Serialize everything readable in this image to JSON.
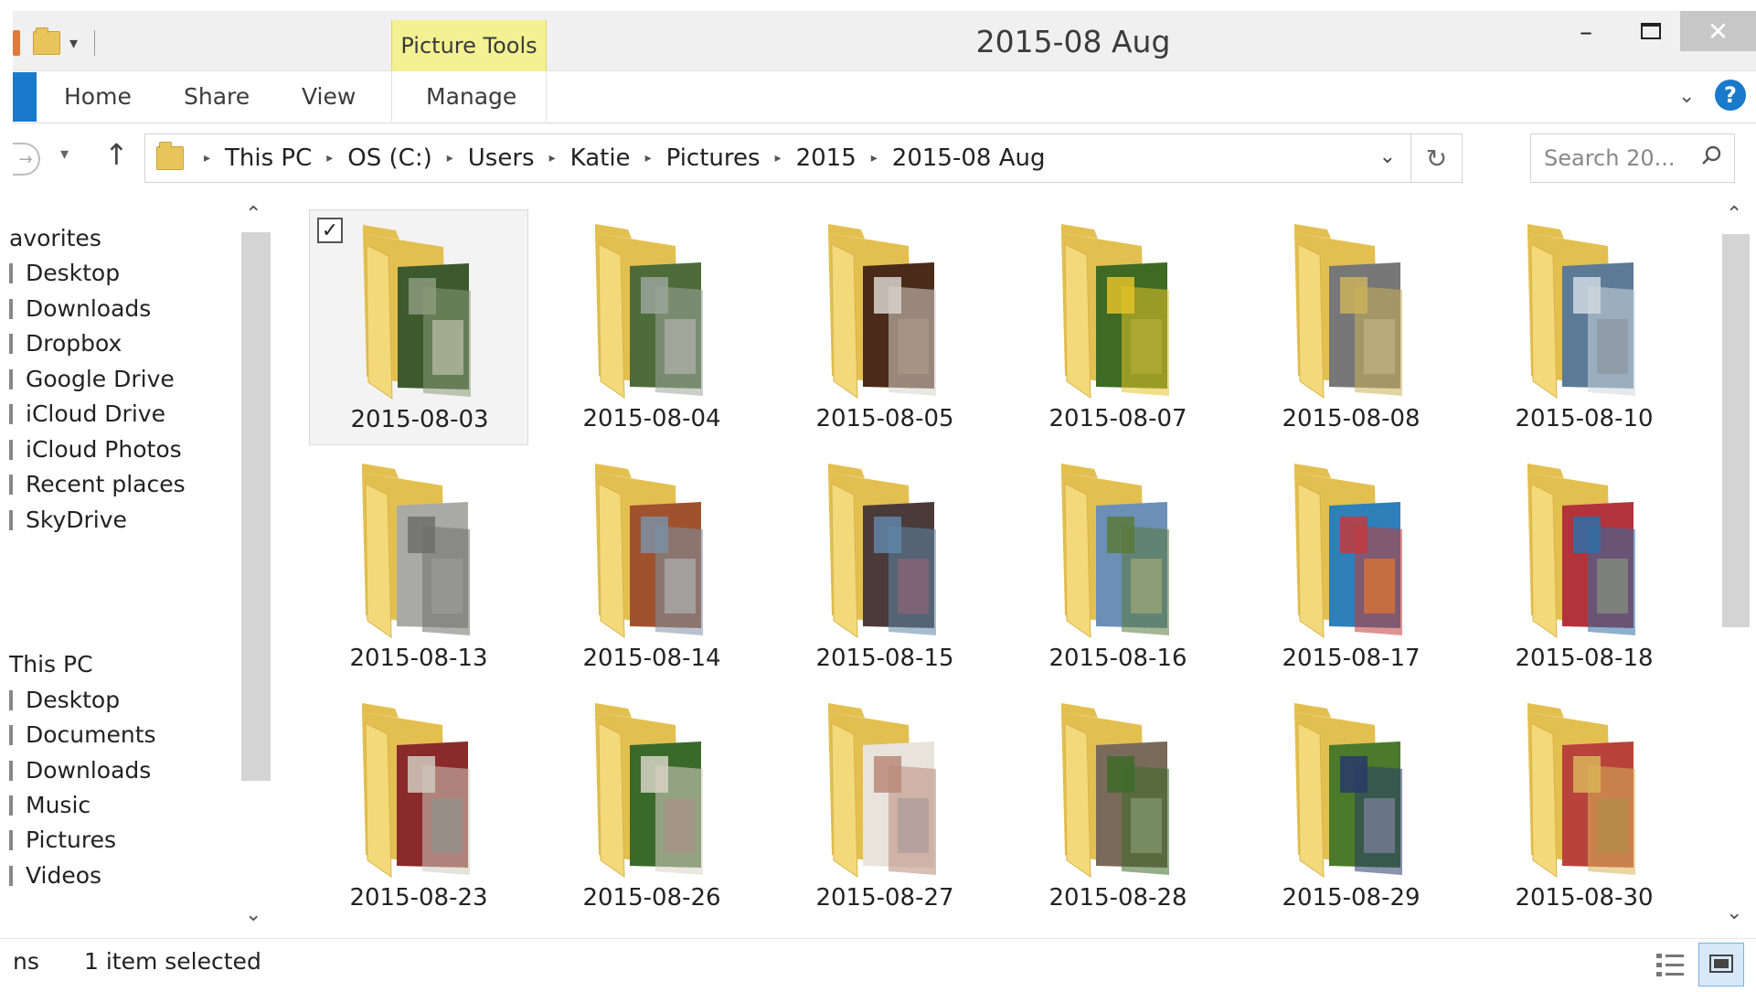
{
  "window": {
    "title": "2015-08 Aug",
    "context_tab": "Picture Tools",
    "minimize_label": "–",
    "close_label": "✕"
  },
  "ribbon": {
    "tabs": [
      "Home",
      "Share",
      "View",
      "Manage"
    ]
  },
  "address": {
    "crumbs": [
      "This PC",
      "OS (C:)",
      "Users",
      "Katie",
      "Pictures",
      "2015",
      "2015-08 Aug"
    ],
    "search_placeholder": "Search 20..."
  },
  "navpane": {
    "favorites_header": "avorites",
    "favorites": [
      "Desktop",
      "Downloads",
      "Dropbox",
      "Google Drive",
      "iCloud Drive",
      "iCloud Photos",
      "Recent places",
      "SkyDrive"
    ],
    "thispc_header": "This PC",
    "thispc": [
      "Desktop",
      "Documents",
      "Downloads",
      "Music",
      "Pictures",
      "Videos"
    ]
  },
  "folders": [
    {
      "name": "2015-08-03",
      "selected": true,
      "colors": [
        "#3c5a2e",
        "#8a9a7a",
        "#d9d2c4"
      ]
    },
    {
      "name": "2015-08-04",
      "selected": false,
      "colors": [
        "#4e6b3a",
        "#9aa59a",
        "#b8b2aa"
      ]
    },
    {
      "name": "2015-08-05",
      "selected": false,
      "colors": [
        "#4a2a18",
        "#d8d4cc",
        "#6e4a2e"
      ]
    },
    {
      "name": "2015-08-07",
      "selected": false,
      "colors": [
        "#3e6a24",
        "#e3c22a",
        "#6f8a3c"
      ]
    },
    {
      "name": "2015-08-08",
      "selected": false,
      "colors": [
        "#777777",
        "#c9b25a",
        "#a7a7a7"
      ]
    },
    {
      "name": "2015-08-10",
      "selected": false,
      "colors": [
        "#5c7a96",
        "#cfd8e0",
        "#3e4c5a"
      ]
    },
    {
      "name": "2015-08-13",
      "selected": false,
      "colors": [
        "#a9aaa6",
        "#6f706c",
        "#c8c9c5"
      ]
    },
    {
      "name": "2015-08-14",
      "selected": false,
      "colors": [
        "#a0522d",
        "#7b8fa6",
        "#d8c2a8"
      ]
    },
    {
      "name": "2015-08-15",
      "selected": false,
      "colors": [
        "#4a3a38",
        "#5f86a8",
        "#b23a3a"
      ]
    },
    {
      "name": "2015-08-16",
      "selected": false,
      "colors": [
        "#6c8fb8",
        "#5a7a3a",
        "#d9d0c0"
      ]
    },
    {
      "name": "2015-08-17",
      "selected": false,
      "colors": [
        "#2f7fb8",
        "#c23b3b",
        "#e4b23a"
      ]
    },
    {
      "name": "2015-08-18",
      "selected": false,
      "colors": [
        "#b2343a",
        "#2f6fa8",
        "#e0a84a"
      ]
    },
    {
      "name": "2015-08-23",
      "selected": false,
      "colors": [
        "#8a2a2a",
        "#d0cac0",
        "#4a4a4a"
      ]
    },
    {
      "name": "2015-08-26",
      "selected": false,
      "colors": [
        "#3a6a2a",
        "#d8d2c6",
        "#6a4a3a"
      ]
    },
    {
      "name": "2015-08-27",
      "selected": false,
      "colors": [
        "#e8e4dc",
        "#b88a7a",
        "#a8b8c8"
      ]
    },
    {
      "name": "2015-08-28",
      "selected": false,
      "colors": [
        "#7a6a5a",
        "#3e6a2a",
        "#c8c0b0"
      ]
    },
    {
      "name": "2015-08-29",
      "selected": false,
      "colors": [
        "#4a7a2a",
        "#2a3a6a",
        "#c8c8c0"
      ]
    },
    {
      "name": "2015-08-30",
      "selected": false,
      "colors": [
        "#b8433a",
        "#d8b45a",
        "#8a5a3a"
      ]
    }
  ],
  "status": {
    "count_fragment": "ns",
    "selected_text": "1 item selected"
  },
  "colors": {
    "accent": "#1979ca",
    "context_tab": "#f3f192",
    "folder": "#f3d97a",
    "folder_dark": "#e3bf50"
  }
}
